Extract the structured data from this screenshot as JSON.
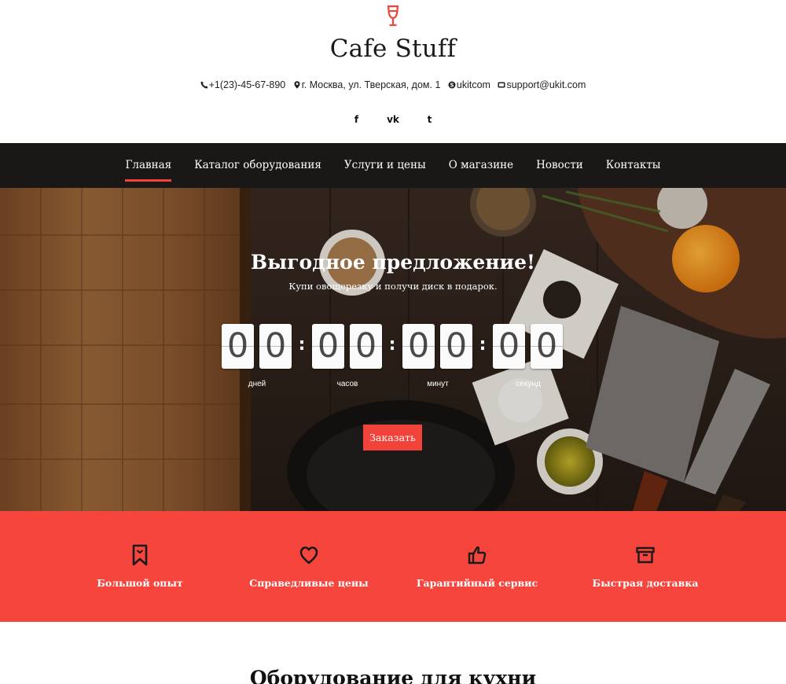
{
  "header": {
    "brand": "Cafe Stuff",
    "logo_icon": "wine-glass-icon",
    "accent_color": "#f2433a",
    "contacts": {
      "phone": "+1(23)-45-67-890",
      "address": "г. Москва, ул. Тверская, дом. 1",
      "skype": "ukitcom",
      "email": "support@ukit.com"
    },
    "social": [
      "facebook-icon",
      "vk-icon",
      "twitter-icon"
    ],
    "social_glyphs": {
      "facebook": "f",
      "vk": "vk",
      "twitter": "t"
    }
  },
  "nav": {
    "items": [
      {
        "label": "Главная",
        "active": true
      },
      {
        "label": "Каталог оборудования",
        "active": false
      },
      {
        "label": "Услуги и цены",
        "active": false
      },
      {
        "label": "О магазине",
        "active": false
      },
      {
        "label": "Новости",
        "active": false
      },
      {
        "label": "Контакты",
        "active": false
      }
    ]
  },
  "hero": {
    "title": "Выгодное предложение!",
    "subtitle": "Купи овощерезку и получи диск в подарок.",
    "countdown": {
      "digits": [
        "0",
        "0",
        "0",
        "0",
        "0",
        "0",
        "0",
        "0"
      ],
      "labels": [
        "дней",
        "часов",
        "минут",
        "секунд"
      ]
    },
    "button_label": "Заказать"
  },
  "features": [
    {
      "icon": "bookmark-icon",
      "label": "Большой опыт"
    },
    {
      "icon": "heart-icon",
      "label": "Справедливые цены"
    },
    {
      "icon": "thumbs-up-icon",
      "label": "Гарантийный сервис"
    },
    {
      "icon": "archive-box-icon",
      "label": "Быстрая доставка"
    }
  ],
  "features_bg_color": "#f5453c",
  "section": {
    "title": "Оборудование для кухни"
  }
}
